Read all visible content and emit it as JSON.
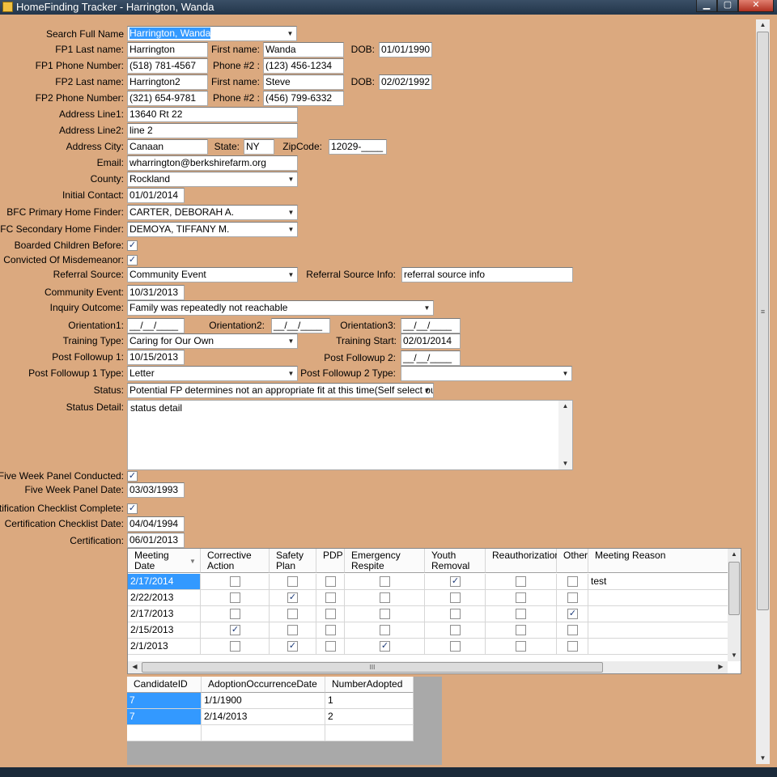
{
  "window": {
    "title": "HomeFinding Tracker - Harrington, Wanda",
    "min_glyph": "▁",
    "max_glyph": "▢",
    "close_glyph": "✕"
  },
  "icons": {
    "app": "app-icon",
    "dropdown": "▼",
    "check": "✓",
    "up": "▲",
    "down": "▼",
    "left": "◀",
    "right": "▶",
    "grip": "≡",
    "hgrip": "III",
    "sort": "▼"
  },
  "form": {
    "search_full_name": {
      "label": "Search Full Name",
      "value": "Harrington, Wanda"
    },
    "fp1_last_name": {
      "label": "FP1 Last name:",
      "value": "Harrington"
    },
    "fp1_first_name": {
      "label": "First name:",
      "value": "Wanda"
    },
    "fp1_dob": {
      "label": "DOB:",
      "value": "01/01/1990"
    },
    "fp1_phone": {
      "label": "FP1 Phone Number:",
      "value": "(518) 781-4567"
    },
    "fp1_phone2": {
      "label": "Phone #2 :",
      "value": "(123) 456-1234"
    },
    "fp2_last_name": {
      "label": "FP2 Last name:",
      "value": "Harrington2"
    },
    "fp2_first_name": {
      "label": "First name:",
      "value": "Steve"
    },
    "fp2_dob": {
      "label": "DOB:",
      "value": "02/02/1992"
    },
    "fp2_phone": {
      "label": "FP2 Phone Number:",
      "value": "(321) 654-9781"
    },
    "fp2_phone2": {
      "label": "Phone #2 :",
      "value": "(456) 799-6332"
    },
    "address_line1": {
      "label": "Address Line1:",
      "value": "13640 Rt 22"
    },
    "address_line2": {
      "label": "Address Line2:",
      "value": "line 2"
    },
    "address_city": {
      "label": "Address City:",
      "value": "Canaan"
    },
    "state": {
      "label": "State:",
      "value": "NY"
    },
    "zip": {
      "label": "ZipCode:",
      "value": "12029-____"
    },
    "email": {
      "label": "Email:",
      "value": "wharrington@berkshirefarm.org"
    },
    "county": {
      "label": "County:",
      "value": "Rockland"
    },
    "initial_contact": {
      "label": "Initial Contact:",
      "value": "01/01/2014"
    },
    "primary_home_finder": {
      "label": "BFC Primary Home Finder:",
      "value": "CARTER, DEBORAH A."
    },
    "secondary_home_finder": {
      "label": "BFC Secondary Home Finder:",
      "value": "DEMOYA, TIFFANY M."
    },
    "boarded_children_before": {
      "label": "Boarded Children Before:",
      "checked": true
    },
    "convicted_misdemeanor": {
      "label": "Convicted Of Misdemeanor:",
      "checked": true
    },
    "referral_source": {
      "label": "Referral Source:",
      "value": "Community Event"
    },
    "referral_source_info": {
      "label": "Referral Source Info:",
      "value": "referral source info"
    },
    "community_event": {
      "label": "Community Event:",
      "value": "10/31/2013"
    },
    "inquiry_outcome": {
      "label": "Inquiry Outcome:",
      "value": "Family was repeatedly not reachable"
    },
    "orientation1": {
      "label": "Orientation1:",
      "value": "__/__/____"
    },
    "orientation2": {
      "label": "Orientation2:",
      "value": "__/__/____"
    },
    "orientation3": {
      "label": "Orientation3:",
      "value": "__/__/____"
    },
    "training_type": {
      "label": "Training Type:",
      "value": "Caring for Our Own"
    },
    "training_start": {
      "label": "Training Start:",
      "value": "02/01/2014"
    },
    "post_followup1": {
      "label": "Post Followup 1:",
      "value": "10/15/2013"
    },
    "post_followup2": {
      "label": "Post Followup 2:",
      "value": "__/__/____"
    },
    "post_followup1_type": {
      "label": "Post Followup 1 Type:",
      "value": "Letter"
    },
    "post_followup2_type": {
      "label": "Post Followup 2 Type:",
      "value": ""
    },
    "status": {
      "label": "Status:",
      "value": "Potential FP determines not an appropriate fit at this time(Self select out)"
    },
    "status_detail": {
      "label": "Status Detail:",
      "value": "status detail"
    },
    "five_week_panel_conducted": {
      "label": "Five Week Panel Conducted:",
      "checked": true
    },
    "five_week_panel_date": {
      "label": "Five Week Panel Date:",
      "value": "03/03/1993"
    },
    "cert_checklist_complete": {
      "label": "Certification Checklist Complete:",
      "checked": true
    },
    "cert_checklist_date": {
      "label": "Certification Checklist Date:",
      "value": "04/04/1994"
    },
    "certification": {
      "label": "Certification:",
      "value": "06/01/2013"
    }
  },
  "meetings": {
    "columns": [
      {
        "line1": "Meeting",
        "line2": "Date"
      },
      {
        "line1": "Corrective",
        "line2": "Action"
      },
      {
        "line1": "Safety",
        "line2": "Plan"
      },
      {
        "line1": "PDP",
        "line2": ""
      },
      {
        "line1": "Emergency",
        "line2": "Respite"
      },
      {
        "line1": "Youth",
        "line2": "Removal"
      },
      {
        "line1": "Reauthorization",
        "line2": ""
      },
      {
        "line1": "Other",
        "line2": ""
      },
      {
        "line1": "Meeting Reason",
        "line2": ""
      }
    ],
    "rows": [
      {
        "date": "2/17/2014",
        "checks": [
          false,
          false,
          false,
          false,
          true,
          false,
          false
        ],
        "reason": "test"
      },
      {
        "date": "2/22/2013",
        "checks": [
          false,
          true,
          false,
          false,
          false,
          false,
          false
        ],
        "reason": ""
      },
      {
        "date": "2/17/2013",
        "checks": [
          false,
          false,
          false,
          false,
          false,
          false,
          true
        ],
        "reason": ""
      },
      {
        "date": "2/15/2013",
        "checks": [
          true,
          false,
          false,
          false,
          false,
          false,
          false
        ],
        "reason": ""
      },
      {
        "date": "2/1/2013",
        "checks": [
          false,
          true,
          false,
          true,
          false,
          false,
          false
        ],
        "reason": ""
      }
    ]
  },
  "adoptions": {
    "columns": [
      "CandidateID",
      "AdoptionOccurrenceDate",
      "NumberAdopted"
    ],
    "rows": [
      [
        "7",
        "1/1/1900",
        "1"
      ],
      [
        "7",
        "2/14/2013",
        "2"
      ],
      [
        "",
        "",
        ""
      ]
    ]
  }
}
